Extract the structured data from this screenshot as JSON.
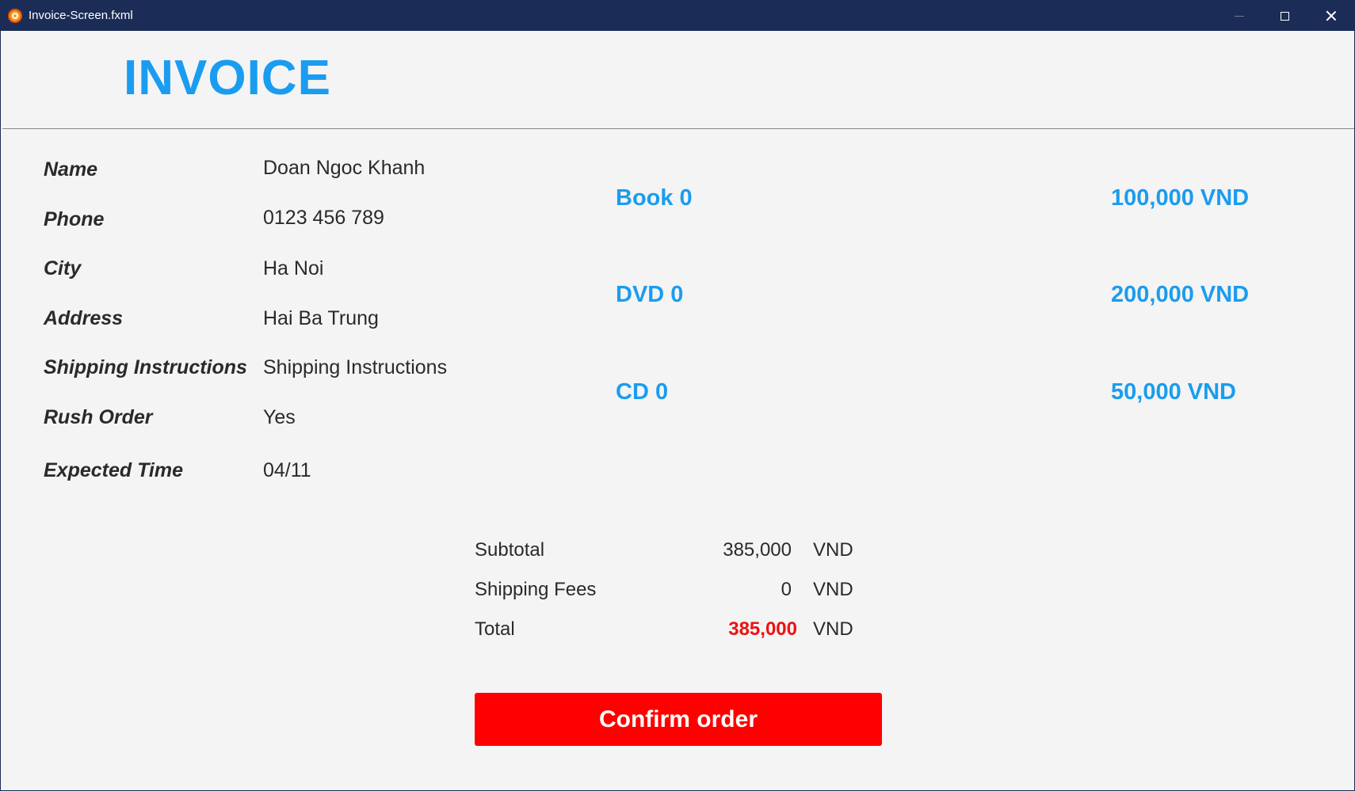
{
  "window": {
    "title": "Invoice-Screen.fxml"
  },
  "header": {
    "title": "INVOICE"
  },
  "customer": {
    "fields": [
      {
        "label": "Name",
        "value": "Doan Ngoc Khanh"
      },
      {
        "label": "Phone",
        "value": "0123 456 789"
      },
      {
        "label": "City",
        "value": "Ha Noi"
      },
      {
        "label": "Address",
        "value": "Hai Ba Trung"
      },
      {
        "label": "Shipping Instructions",
        "value": "Shipping Instructions"
      },
      {
        "label": "Rush Order",
        "value": "Yes"
      },
      {
        "label": "Expected Time",
        "value": "04/11"
      }
    ]
  },
  "items": [
    {
      "name": "Book 0",
      "price": "100,000 VND"
    },
    {
      "name": "DVD 0",
      "price": "200,000 VND"
    },
    {
      "name": "CD 0",
      "price": "50,000 VND"
    }
  ],
  "summary": {
    "subtotal": {
      "label": "Subtotal",
      "value": "385,000",
      "unit": "VND"
    },
    "shipping": {
      "label": "Shipping Fees",
      "value": "0",
      "unit": "VND"
    },
    "total": {
      "label": "Total",
      "value": "385,000",
      "unit": "VND"
    }
  },
  "actions": {
    "confirm_label": "Confirm order"
  },
  "colors": {
    "accent": "#1a9cf0",
    "total": "#ee1111",
    "confirm_button": "#ff0000",
    "titlebar": "#1b2d57"
  }
}
